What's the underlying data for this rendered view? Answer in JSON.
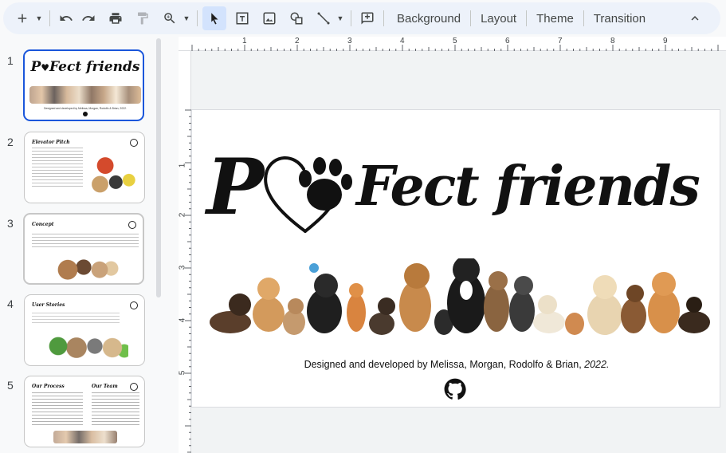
{
  "toolbar": {
    "menu_background": "Background",
    "menu_layout": "Layout",
    "menu_theme": "Theme",
    "menu_transition": "Transition"
  },
  "filmstrip": {
    "slides": [
      {
        "number": "1",
        "title": "PawFect friends",
        "credit": "Designed and developed by Melissa, Morgan, Rodolfo & Brian, 2022."
      },
      {
        "number": "2",
        "title": "Elevator Pitch"
      },
      {
        "number": "3",
        "title": "Concept"
      },
      {
        "number": "4",
        "title": "User Stories"
      },
      {
        "number": "5",
        "title_left": "Our Process",
        "title_right": "Our Team"
      }
    ]
  },
  "ruler": {
    "h_labels": [
      "1",
      "2",
      "3",
      "4",
      "5",
      "6",
      "7",
      "8",
      "9"
    ],
    "v_labels": [
      "1",
      "2",
      "3",
      "4",
      "5"
    ]
  },
  "slide": {
    "title_left": "P",
    "title_right": "Fect friends",
    "credits_prefix": "Designed and developed by Melissa, Morgan, Rodolfo & Brian, ",
    "credits_year": "2022.",
    "colors": {
      "accent": "#1a56db",
      "text": "#111111"
    }
  }
}
